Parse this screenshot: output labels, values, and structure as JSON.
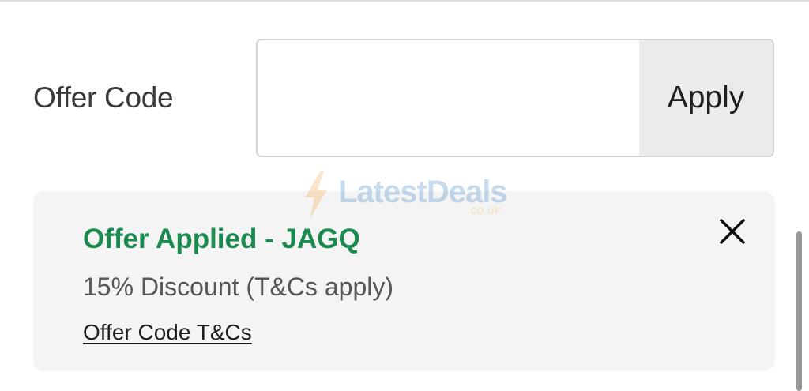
{
  "offer_code": {
    "label": "Offer Code",
    "input_value": "",
    "apply_label": "Apply"
  },
  "offer_card": {
    "title": "Offer Applied - JAGQ",
    "description": "15% Discount (T&Cs apply)",
    "tcs_link": "Offer Code T&Cs",
    "close_icon": "close-icon"
  },
  "watermark": {
    "brand": "LatestDeals",
    "suffix": ".co.uk"
  },
  "colors": {
    "success_green": "#1a8a4f",
    "card_background": "#f4f4f4",
    "button_background": "#ebebeb"
  }
}
